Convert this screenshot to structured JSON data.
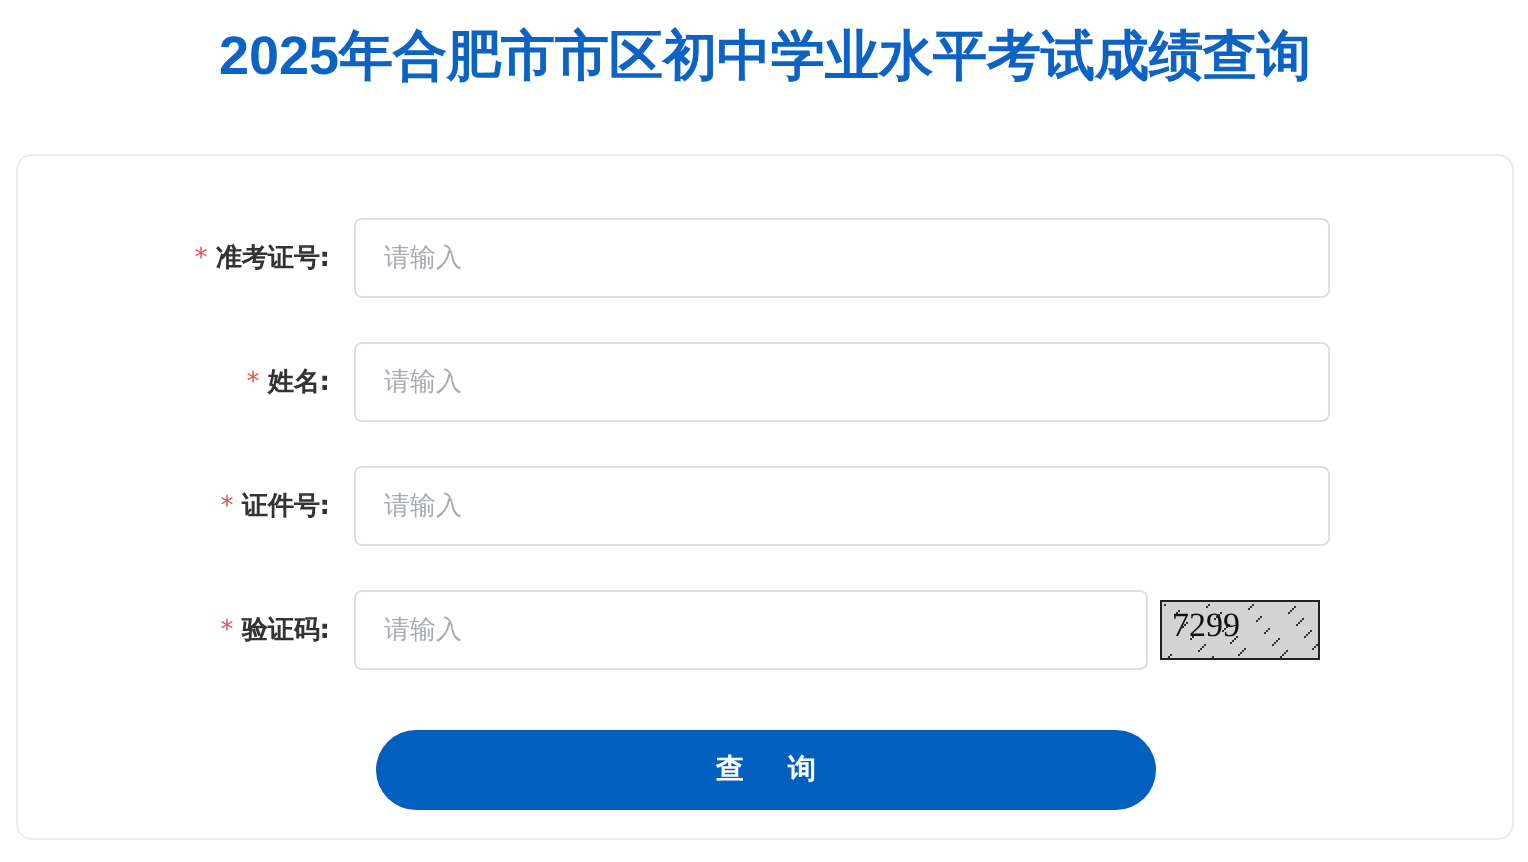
{
  "title": "2025年合肥市市区初中学业水平考试成绩查询",
  "fields": [
    {
      "kind": "text",
      "marker": "*",
      "label": "准考证号:",
      "placeholder": "请输入"
    },
    {
      "kind": "text",
      "marker": "*",
      "label": "姓名:",
      "placeholder": "请输入"
    },
    {
      "kind": "text",
      "marker": "*",
      "label": "证件号:",
      "placeholder": "请输入"
    },
    {
      "kind": "captcha",
      "marker": "*",
      "label": "验证码:",
      "placeholder": "请输入",
      "captcha": "7299"
    }
  ],
  "submit": "查询"
}
